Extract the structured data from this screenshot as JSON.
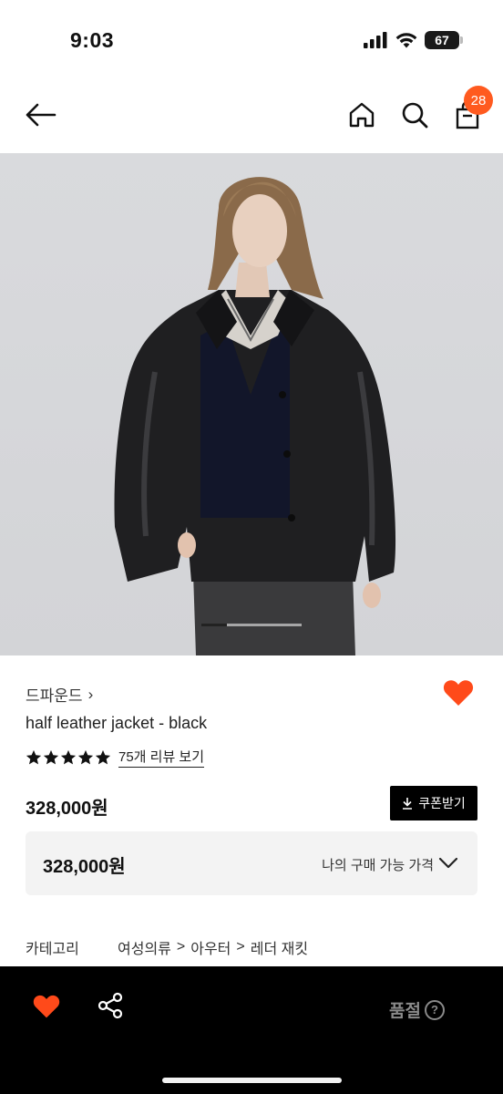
{
  "status_bar": {
    "time": "9:03",
    "battery": "67"
  },
  "header": {
    "cart_count": "28"
  },
  "hero": {
    "image_alt": "model wearing black leather jacket",
    "carousel_progress": 0.25
  },
  "product": {
    "brand": "드파운드",
    "brand_chevron": "›",
    "name": "half leather jacket - black",
    "rating_stars": 5,
    "review_link": "75개 리뷰 보기",
    "price": "328,000원",
    "coupon_button": "쿠폰받기",
    "my_price": {
      "value": "328,000원",
      "label": "나의 구매 가능 가격"
    },
    "category": {
      "title": "카테고리",
      "path": [
        "여성의류",
        "아우터",
        "레더 재킷"
      ],
      "separator": ">"
    }
  },
  "bottom_bar": {
    "soldout_label": "품절",
    "help_glyph": "?"
  },
  "colors": {
    "accent": "#ff5a1f",
    "heart": "#ff4a1a",
    "bottom_bar": "#000000",
    "muted": "#8a8a8a"
  }
}
